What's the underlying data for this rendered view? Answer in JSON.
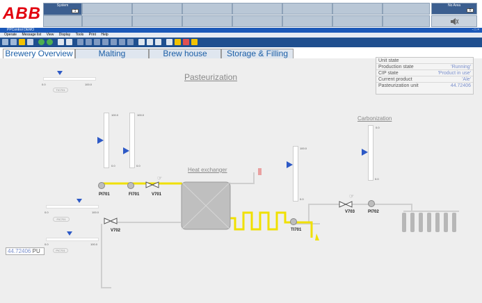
{
  "alarm_band": {
    "logo": "ABB",
    "system_label": "System",
    "system_count": "1",
    "area_label": "No Area",
    "area_count": "0"
  },
  "window": {
    "title": "PPControl DEMO",
    "controls": "- □ ×"
  },
  "menu": [
    "Operate",
    "Message list",
    "View",
    "Display",
    "Tools",
    "Print",
    "Help"
  ],
  "tabs": [
    {
      "label": "Brewery Overview",
      "active": true
    },
    {
      "label": "Malting",
      "active": false
    },
    {
      "label": "Brew house",
      "active": false
    },
    {
      "label": "Storage & Filling",
      "active": false
    }
  ],
  "unit_state": {
    "title": "Unit state",
    "rows": [
      {
        "label": "Production state",
        "value": "'Running'"
      },
      {
        "label": "CIP state",
        "value": "'Product in use'"
      },
      {
        "label": "Current product",
        "value": "'Ale'"
      },
      {
        "label": "Pasteurization unit",
        "value": "44.72406"
      }
    ]
  },
  "headings": {
    "pasteurization": "Pasteurization",
    "heat_exchanger": "Heat exchanger",
    "carbonization": "Carbonization"
  },
  "instruments": {
    "pi701": "PI701",
    "fi701": "FI701",
    "v701": "V701",
    "v702": "V702",
    "ti701": "TI701",
    "v703": "V703",
    "pi702": "PI702"
  },
  "ranges": {
    "min": "0.0",
    "max": "100.0"
  },
  "controllers": {
    "tic": "TIC701",
    "fic": "FIC701",
    "pic": "PIC701"
  },
  "pu_display": {
    "value": "44.72406",
    "unit": "PU"
  },
  "colors": {
    "brand_red": "#e2000f",
    "pipe_product": "#f0e000",
    "accent_blue": "#2d59c6"
  }
}
